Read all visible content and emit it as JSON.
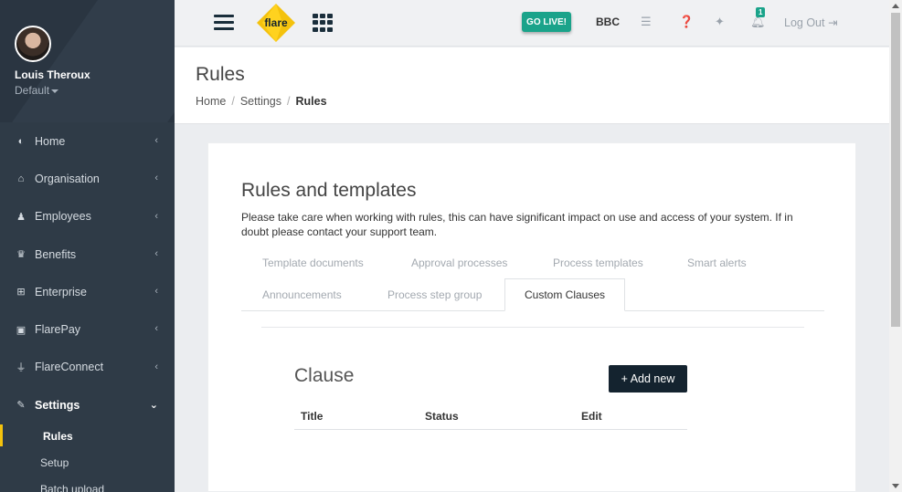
{
  "profile": {
    "name": "Louis Theroux",
    "role": "Default"
  },
  "nav": {
    "items": [
      {
        "label": "Home",
        "icon": "dashboard-icon",
        "glyph": "◐"
      },
      {
        "label": "Organisation",
        "icon": "bank-icon",
        "glyph": "⌂"
      },
      {
        "label": "Employees",
        "icon": "users-icon",
        "glyph": "♟"
      },
      {
        "label": "Benefits",
        "icon": "trophy-icon",
        "glyph": "♛"
      },
      {
        "label": "Enterprise",
        "icon": "sitemap-icon",
        "glyph": "⊞"
      },
      {
        "label": "FlarePay",
        "icon": "money-icon",
        "glyph": "▣"
      },
      {
        "label": "FlareConnect",
        "icon": "plug-icon",
        "glyph": "⏚"
      },
      {
        "label": "Settings",
        "icon": "edit-icon",
        "glyph": "✎"
      }
    ],
    "settings_sub": [
      {
        "label": "Rules"
      },
      {
        "label": "Setup"
      },
      {
        "label": "Batch upload"
      }
    ]
  },
  "topbar": {
    "logo_text": "flare",
    "go_live": "GO LIVE!",
    "org": "BBC",
    "notifications_count": "1",
    "logout": "Log Out"
  },
  "page": {
    "title": "Rules",
    "breadcrumb": [
      "Home",
      "Settings",
      "Rules"
    ]
  },
  "card": {
    "title": "Rules and templates",
    "description": "Please take care when working with rules, this can have significant impact on use and access of your system. If in doubt please contact your support team.",
    "tabs_row1": [
      "Template documents",
      "Approval processes",
      "Process templates",
      "Smart alerts"
    ],
    "tabs_row2": [
      "Announcements",
      "Process step group"
    ],
    "active_tab": "Custom Clauses"
  },
  "clause": {
    "title": "Clause",
    "add_button": "+ Add new",
    "columns": [
      "Title",
      "Status",
      "Edit"
    ]
  },
  "colors": {
    "sidebar": "#2f3b47",
    "accent": "#1aa38a",
    "brand_yellow": "#f4c20d",
    "dark_button": "#14232f"
  }
}
